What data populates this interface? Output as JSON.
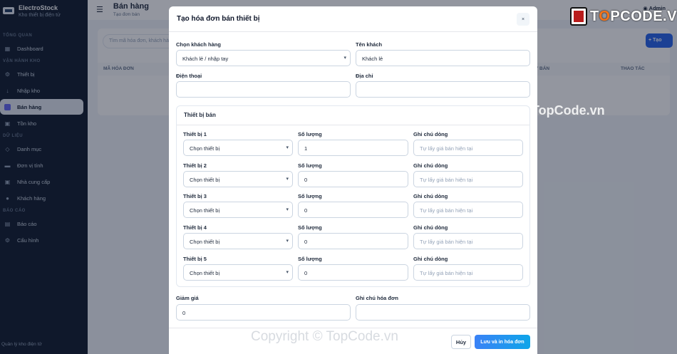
{
  "sidebar": {
    "brand_name": "ElectroStock",
    "brand_sub": "Kho thiết bị điện tử",
    "sections": {
      "overview": "TỔNG QUAN",
      "operations": "VẬN HÀNH KHO",
      "data": "DỮ LIỆU",
      "reports": "BÁO CÁO"
    },
    "items": {
      "dashboard": "Dashboard",
      "devices": "Thiết bị",
      "import": "Nhập kho",
      "sales": "Bán hàng",
      "stock": "Tồn kho",
      "categories": "Danh mục",
      "units": "Đơn vị tính",
      "suppliers": "Nhà cung cấp",
      "customers": "Khách hàng",
      "report": "Báo cáo",
      "settings": "Cấu hình"
    },
    "footer": "Quản lý kho điện tử"
  },
  "main": {
    "page_title": "Bán hàng",
    "page_sub": "Tạo đơn bán",
    "admin": "Admin",
    "search_placeholder": "Tìm mã hóa đơn, khách hàng...",
    "create_label": "+ Tạo",
    "columns": {
      "invoice_code": "MÃ HÓA ĐƠN",
      "sale_date": "Y BÁN",
      "actions": "THAO TÁC"
    }
  },
  "modal": {
    "title": "Tạo hóa đơn bán thiết bị",
    "close": "×",
    "customer_select_label": "Chọn khách hàng",
    "customer_select_value": "Khách lẻ / nhập tay",
    "customer_name_label": "Tên khách",
    "customer_name_value": "Khách lẻ",
    "phone_label": "Điện thoại",
    "phone_value": "",
    "address_label": "Địa chỉ",
    "address_value": "",
    "devices_title": "Thiết bị bán",
    "device_rows": [
      {
        "device_label": "Thiết bị 1",
        "device_value": "Chọn thiết bị",
        "qty_label": "Số lượng",
        "qty_value": "1",
        "note_label": "Ghi chú dòng",
        "note_placeholder": "Tự lấy giá bán hiện tại"
      },
      {
        "device_label": "Thiết bị 2",
        "device_value": "Chọn thiết bị",
        "qty_label": "Số lượng",
        "qty_value": "0",
        "note_label": "Ghi chú dòng",
        "note_placeholder": "Tự lấy giá bán hiện tại"
      },
      {
        "device_label": "Thiết bị 3",
        "device_value": "Chọn thiết bị",
        "qty_label": "Số lượng",
        "qty_value": "0",
        "note_label": "Ghi chú dòng",
        "note_placeholder": "Tự lấy giá bán hiện tại"
      },
      {
        "device_label": "Thiết bị 4",
        "device_value": "Chọn thiết bị",
        "qty_label": "Số lượng",
        "qty_value": "0",
        "note_label": "Ghi chú dòng",
        "note_placeholder": "Tự lấy giá bán hiện tại"
      },
      {
        "device_label": "Thiết bị 5",
        "device_value": "Chọn thiết bị",
        "qty_label": "Số lượng",
        "qty_value": "0",
        "note_label": "Ghi chú dòng",
        "note_placeholder": "Tự lấy giá bán hiện tại"
      }
    ],
    "discount_label": "Giảm giá",
    "discount_value": "0",
    "invoice_note_label": "Ghi chú hóa đơn",
    "invoice_note_value": "",
    "cancel_label": "Hủy",
    "save_label": "Lưu và in hóa đơn"
  },
  "watermarks": {
    "logo_text_pre": "T",
    "logo_text_o": "O",
    "logo_text_post": "PCODE.VN",
    "mid": "TopCode.vn",
    "bottom": "Copyright © TopCode.vn"
  }
}
